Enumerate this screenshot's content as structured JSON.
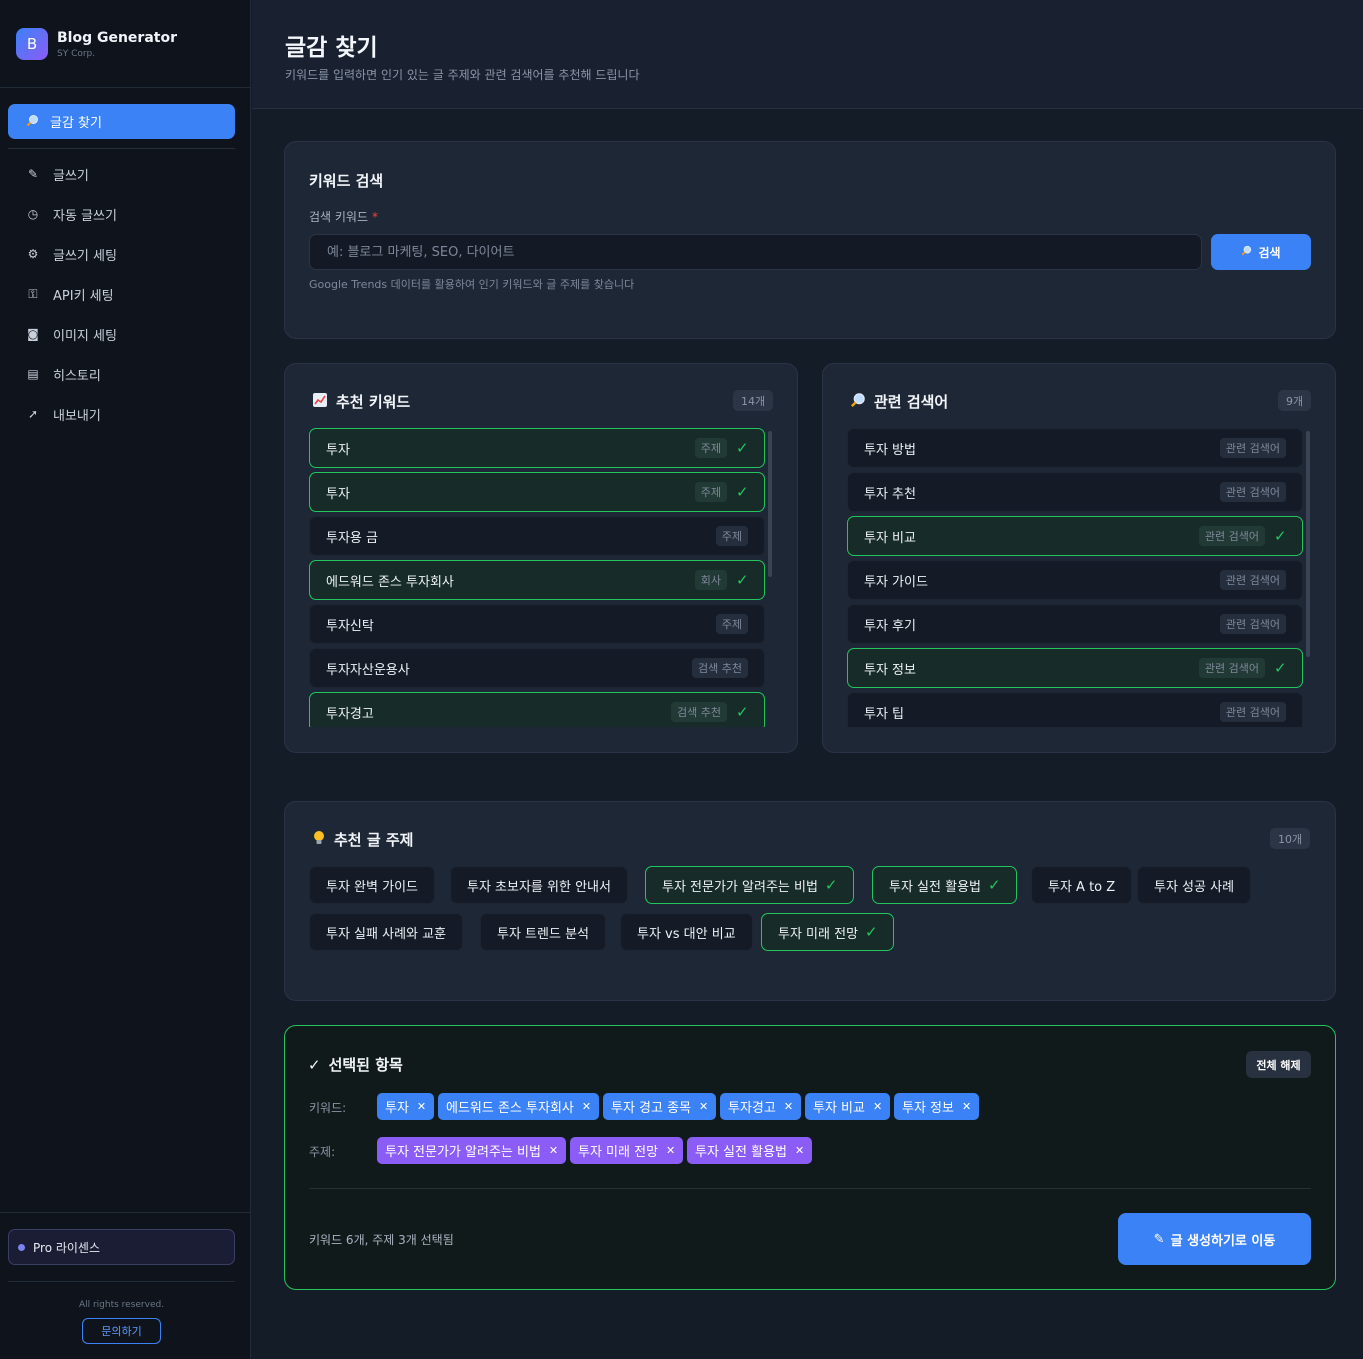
{
  "app": {
    "name": "Blog Generator",
    "company": "SY Corp.",
    "logo_letter": "B"
  },
  "sidebar": {
    "active": {
      "icon": "search-icon",
      "label": "글감 찾기"
    },
    "items": [
      {
        "icon": "pencil-icon",
        "glyph": "✎",
        "label": "글쓰기"
      },
      {
        "icon": "clock-icon",
        "glyph": "◷",
        "label": "자동 글쓰기"
      },
      {
        "icon": "gear-icon",
        "glyph": "⚙",
        "label": "글쓰기 세팅"
      },
      {
        "icon": "key-icon",
        "glyph": "⚿",
        "label": "API키 세팅"
      },
      {
        "icon": "camera-icon",
        "glyph": "◙",
        "label": "이미지 세팅"
      },
      {
        "icon": "document-icon",
        "glyph": "▤",
        "label": "히스토리"
      },
      {
        "icon": "rocket-icon",
        "glyph": "➚",
        "label": "내보내기"
      }
    ],
    "license": "Pro 라이센스",
    "rights": "All rights reserved.",
    "contact": "문의하기"
  },
  "header": {
    "title": "글감 찾기",
    "subtitle": "키워드를 입력하면 인기 있는 글 주제와 관련 검색어를 추천해 드립니다"
  },
  "search": {
    "title": "키워드 검색",
    "label": "검색 키워드",
    "required_mark": "*",
    "placeholder": "예: 블로그 마케팅, SEO, 다이어트",
    "value": "",
    "button": "검색",
    "hint": "Google Trends 데이터를 활용하여 인기 키워드와 글 주제를 찾습니다"
  },
  "keywords": {
    "title": "추천 키워드",
    "count": "14개",
    "items": [
      {
        "label": "투자",
        "tag": "주제",
        "selected": true
      },
      {
        "label": "투자",
        "tag": "주제",
        "selected": true
      },
      {
        "label": "투자용 금",
        "tag": "주제",
        "selected": false
      },
      {
        "label": "에드워드 존스 투자회사",
        "tag": "회사",
        "selected": true
      },
      {
        "label": "투자신탁",
        "tag": "주제",
        "selected": false
      },
      {
        "label": "투자자산운용사",
        "tag": "검색 추천",
        "selected": false
      },
      {
        "label": "투자경고",
        "tag": "검색 추천",
        "selected": true
      }
    ]
  },
  "related": {
    "title": "관련 검색어",
    "count": "9개",
    "items": [
      {
        "label": "투자 방법",
        "tag": "관련 검색어",
        "selected": false
      },
      {
        "label": "투자 추천",
        "tag": "관련 검색어",
        "selected": false
      },
      {
        "label": "투자 비교",
        "tag": "관련 검색어",
        "selected": true
      },
      {
        "label": "투자 가이드",
        "tag": "관련 검색어",
        "selected": false
      },
      {
        "label": "투자 후기",
        "tag": "관련 검색어",
        "selected": false
      },
      {
        "label": "투자 정보",
        "tag": "관련 검색어",
        "selected": true
      },
      {
        "label": "투자 팁",
        "tag": "관련 검색어",
        "selected": false
      }
    ]
  },
  "topics": {
    "title": "추천 글 주제",
    "count": "10개",
    "items": [
      {
        "label": "투자 완벽 가이드",
        "selected": false
      },
      {
        "label": "투자 초보자를 위한 안내서",
        "selected": false
      },
      {
        "label": "투자 전문가가 알려주는 비법",
        "selected": true
      },
      {
        "label": "투자 실전 활용법",
        "selected": true
      },
      {
        "label": "투자 A to Z",
        "selected": false
      },
      {
        "label": "투자 성공 사례",
        "selected": false
      },
      {
        "label": "투자 실패 사례와 교훈",
        "selected": false
      },
      {
        "label": "투자 트렌드 분석",
        "selected": false
      },
      {
        "label": "투자 vs 대안 비교",
        "selected": false
      },
      {
        "label": "투자 미래 전망",
        "selected": true
      }
    ]
  },
  "selection": {
    "title": "선택된 항목",
    "clear": "전체 해제",
    "keywords_label": "키워드:",
    "keywords": [
      "투자",
      "에드워드 존스 투자회사",
      "투자 경고 종목",
      "투자경고",
      "투자 비교",
      "투자 정보"
    ],
    "topics_label": "주제:",
    "topics": [
      "투자 전문가가 알려주는 비법",
      "투자 미래 전망",
      "투자 실전 활용법"
    ],
    "summary": "키워드 6개, 주제 3개 선택됨",
    "go_button": "글 생성하기로 이동"
  },
  "colors": {
    "accent": "#3b82f6",
    "success": "#22c55e",
    "topic_pill": "#8b5cf6"
  }
}
